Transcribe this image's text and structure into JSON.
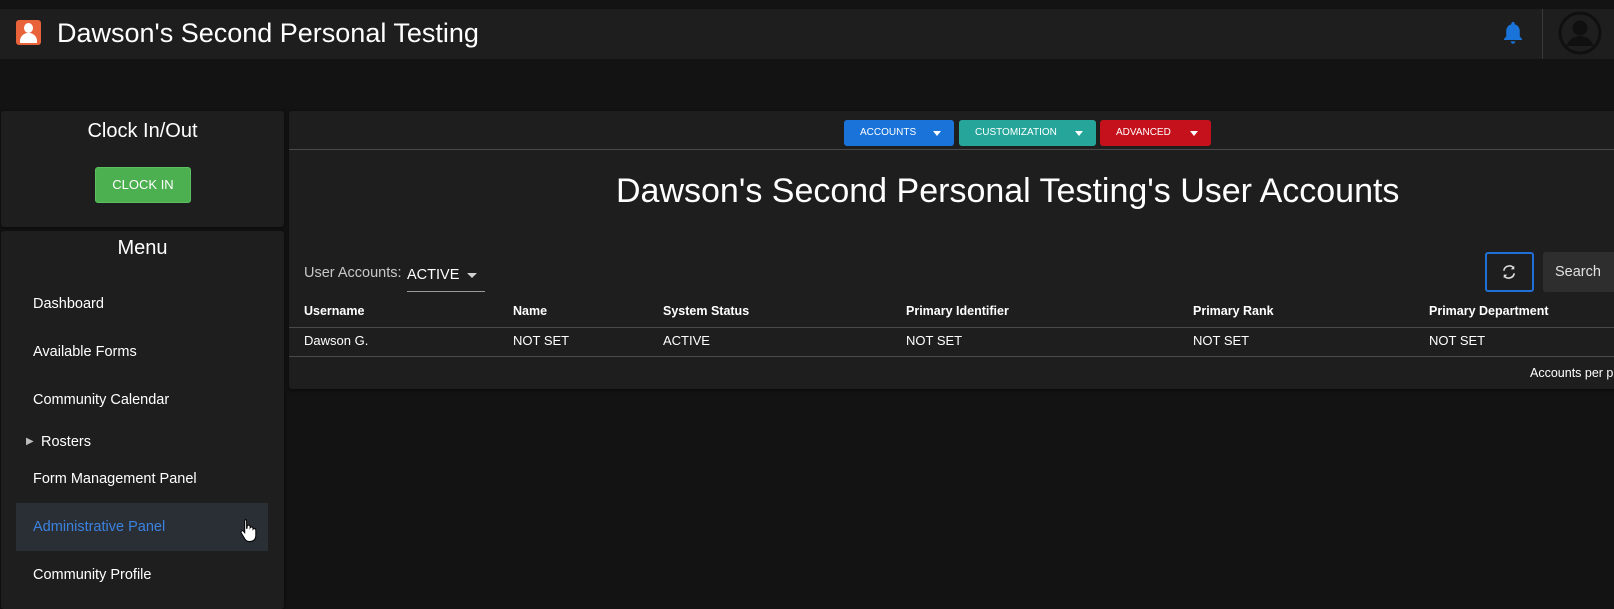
{
  "header": {
    "app_title": "Dawson's Second Personal Testing",
    "icons": [
      "app-logo-icon",
      "bell-icon",
      "user-avatar-icon"
    ],
    "bell_color": "#1a73d9"
  },
  "clock": {
    "title": "Clock In/Out",
    "button_label": "CLOCK IN",
    "button_color": "#4caf50"
  },
  "menu": {
    "title": "Menu",
    "items": [
      {
        "label": "Dashboard"
      },
      {
        "label": "Available Forms"
      },
      {
        "label": "Community Calendar"
      },
      {
        "label": "Rosters",
        "collapsible": true
      },
      {
        "label": "Form Management Panel"
      },
      {
        "label": "Administrative Panel",
        "active": true
      },
      {
        "label": "Community Profile"
      }
    ],
    "active_color": "#3b82e0"
  },
  "toolbar": {
    "accounts_label": "ACCOUNTS",
    "customization_label": "CUSTOMIZATION",
    "advanced_label": "ADVANCED",
    "colors": {
      "accounts": "#1a73d9",
      "customization": "#26a69a",
      "advanced": "#c4111b"
    }
  },
  "main": {
    "page_title": "Dawson's Second Personal Testing's User Accounts",
    "filter_label": "User Accounts:",
    "filter_value": "ACTIVE",
    "search_label": "Search",
    "per_page_label": "Accounts per p"
  },
  "table": {
    "columns": [
      "Username",
      "Name",
      "System Status",
      "Primary Identifier",
      "Primary Rank",
      "Primary Department"
    ],
    "rows": [
      [
        "Dawson G.",
        "NOT SET",
        "ACTIVE",
        "NOT SET",
        "NOT SET",
        "NOT SET"
      ]
    ]
  }
}
